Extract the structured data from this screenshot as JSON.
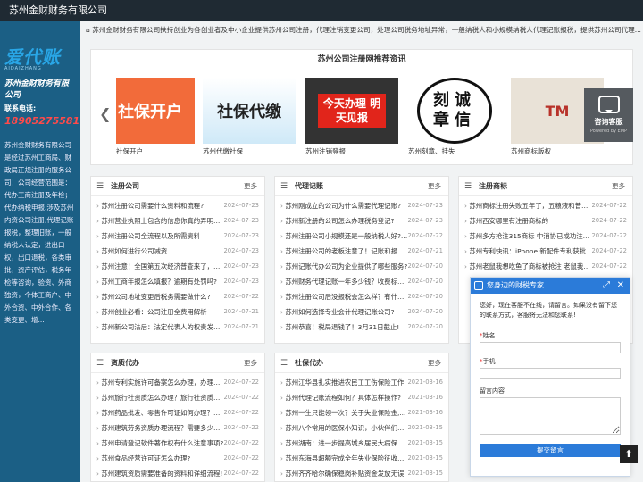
{
  "header": {
    "title": "苏州金财财务有限公司"
  },
  "sidebar": {
    "logo_text": "爱代账",
    "logo_sub": "AIDAIZHANG",
    "company": "苏州金财财务有限公司",
    "phone_label": "联系电话:",
    "phone": "18905275581",
    "description": "苏州金财财务有限公司是经过苏州工商局、财政局正规注册的服务公司！公司经营范围是：代办工商注册及年检；代办纳税申报.涉及苏州内资公司注册,代理记账报税，整理旧账，一般纳税人认定，进出口权，出口退税，各类审批，资产评估，税务年检等咨询，验资、外商独资，个体工商户、中外合资、中外合作、各类变更、增..."
  },
  "notice": {
    "icon": "home-icon",
    "text": "苏州金财财务有限公司扶持创业为各创业者及中小企业提供苏州公司注册，代理注销变更公司，处理公司税务地址异常，一般纳税人和小规模纳税人代理记账报税，提供苏州公司代理..."
  },
  "carousel": {
    "title": "苏州公司注册网推荐资讯",
    "slides": [
      {
        "caption": "社保开户",
        "img_text": "社保开户"
      },
      {
        "caption": "苏州代缴社保",
        "img_text": "社保代缴"
      },
      {
        "caption": "苏州注销登报",
        "img_text": "今天办理 明天见报"
      },
      {
        "caption": "苏州刻章、挂失",
        "img_text": "刻诚 章信"
      },
      {
        "caption": "苏州商标版权",
        "img_text": "TM"
      }
    ]
  },
  "consult": {
    "label": "咨询客服",
    "powered": "Powered by EMP"
  },
  "panels": [
    {
      "title": "注册公司",
      "more": "更多",
      "items": [
        {
          "t": "苏州注册公司需要什么资料和流程?",
          "d": "2024-07-23"
        },
        {
          "t": "苏州营业执照上包含的信息你真的弄明白...",
          "d": "2024-07-23"
        },
        {
          "t": "苏州注册公司全流程以及所需资料",
          "d": "2024-07-23"
        },
        {
          "t": "苏州如何进行公司减资",
          "d": "2024-07-23"
        },
        {
          "t": "苏州注意！全国第五次经济普查来了，企...",
          "d": "2024-07-23"
        },
        {
          "t": "苏州工商年报怎么填报？逾期有处罚吗?",
          "d": "2024-07-23"
        },
        {
          "t": "苏州公司地址变更后税务需要做什么?",
          "d": "2024-07-22"
        },
        {
          "t": "苏州创业必看：公司注册全费用解析",
          "d": "2024-07-21"
        },
        {
          "t": "苏州新公司法后：法定代表人的权责发生...",
          "d": "2024-07-21"
        }
      ]
    },
    {
      "title": "代理记账",
      "more": "更多",
      "items": [
        {
          "t": "苏州刚成立的公司为什么需要代理记账?",
          "d": "2024-07-23"
        },
        {
          "t": "苏州新注册的公司怎么办理税务登记?",
          "d": "2024-07-23"
        },
        {
          "t": "苏州注册公司小规模还是一般纳税人好?有...",
          "d": "2024-07-22"
        },
        {
          "t": "苏州注册公司的老板注意了！记账和报税...",
          "d": "2024-07-21"
        },
        {
          "t": "苏州记账代办公司为企业提供了哪些服务?",
          "d": "2024-07-20"
        },
        {
          "t": "苏州财务代理记账一年多少钱？收费标准...",
          "d": "2024-07-20"
        },
        {
          "t": "苏州注册公司后没报税会怎么样？有什么...",
          "d": "2024-07-20"
        },
        {
          "t": "苏州如何选择专业会计代理记账公司?",
          "d": "2024-07-20"
        },
        {
          "t": "苏州恭喜！税局退钱了！3月31日截止!",
          "d": "2024-07-20"
        }
      ]
    },
    {
      "title": "注册商标",
      "more": "更多",
      "items": [
        {
          "t": "苏州商标注册失败五年了，五粮液和普从...",
          "d": "2024-07-22"
        },
        {
          "t": "苏州西安哪里有注册商标的",
          "d": "2024-07-22"
        },
        {
          "t": "苏州多方抢注315商标 中消协已成功注册31",
          "d": "2024-07-22"
        },
        {
          "t": "苏州专利快讯：iPhone 新配件专利获批",
          "d": "2024-07-22"
        },
        {
          "t": "苏州老鼠我想吃鱼了商标被抢注 老鼠我想...",
          "d": "2024-07-22"
        }
      ]
    },
    {
      "title": "资质代办",
      "more": "更多",
      "items": [
        {
          "t": "苏州专利实施许可备案怎么办理，办理流...",
          "d": "2024-07-22"
        },
        {
          "t": "苏州旅行社资质怎么办理？旅行社资质办...",
          "d": "2024-07-22"
        },
        {
          "t": "苏州药品批发、零售许可证如何办理？办...",
          "d": "2024-07-22"
        },
        {
          "t": "苏州建筑劳务资质办理流程？需要多少费...",
          "d": "2024-07-22"
        },
        {
          "t": "苏州申请登记软件著作权有什么注意事项?",
          "d": "2024-07-22"
        },
        {
          "t": "苏州食品经营许可证怎么办理?",
          "d": "2024-07-22"
        },
        {
          "t": "苏州建筑资质需要准备的资料和详细流程!",
          "d": "2024-07-22"
        }
      ]
    },
    {
      "title": "社保代办",
      "more": "更多",
      "items": [
        {
          "t": "苏州江华县扎实推进农民工工伤保险工作",
          "d": "2021-03-16"
        },
        {
          "t": "苏州代理记账流程如何？具体怎样操作?",
          "d": "2021-03-16"
        },
        {
          "t": "苏州一生只能领一次？关于失业保险金,...",
          "d": "2021-03-16"
        },
        {
          "t": "苏州八个常用的医保小知识，小伙伴们赶...",
          "d": "2021-03-15"
        },
        {
          "t": "苏州湖南：进一步提高城乡居民大病保险...",
          "d": "2021-03-15"
        },
        {
          "t": "苏州东海县超额完成全年失业保险征收任务",
          "d": "2021-03-15"
        },
        {
          "t": "苏州齐齐哈尔确保稳岗补贴资金发放无误",
          "d": "2021-03-15"
        }
      ]
    }
  ],
  "chat": {
    "title": "您身边的财税专家",
    "message": "您好，现在客服不在线，请留言。如果没有留下您的联系方式，客服将无法和您联系!",
    "name_label": "姓名",
    "phone_label": "手机",
    "msg_label": "留言内容",
    "submit": "提交留言"
  },
  "colors": {
    "sidebar": "#1b5f85",
    "topbar": "#1f2a33",
    "accent": "#2b7bd9",
    "phone": "#ff4a4a"
  }
}
